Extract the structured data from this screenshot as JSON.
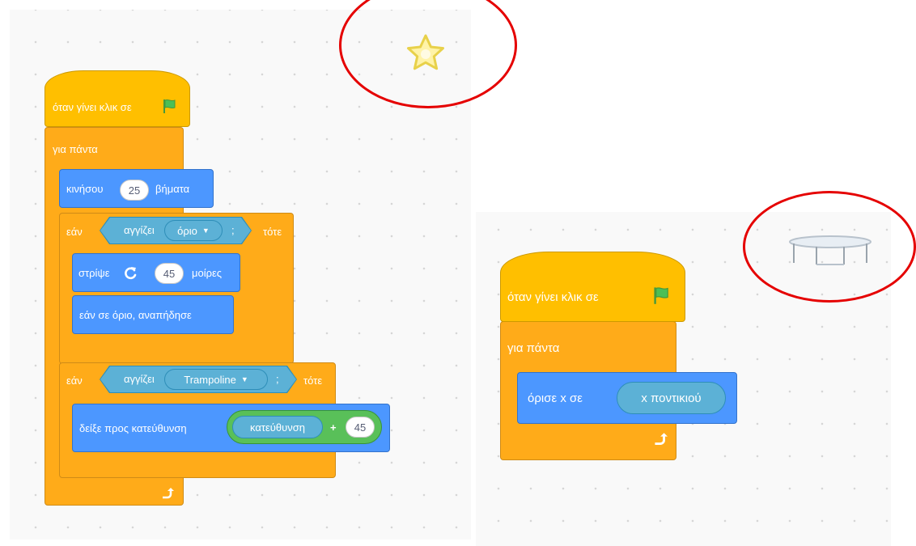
{
  "left_script": {
    "hat_label": "όταν γίνει κλικ σε",
    "forever_label": "για πάντα",
    "move": {
      "label_before": "κινήσου",
      "steps": "25",
      "label_after": "βήματα"
    },
    "if1": {
      "if_label": "εάν",
      "touching_label": "αγγίζει",
      "target": "όριο",
      "then_label": "τότε",
      "question": ";"
    },
    "turn": {
      "label_before": "στρίψε",
      "degrees": "45",
      "label_after": "μοίρες"
    },
    "bounce_label": "εάν σε όριο, αναπήδησε",
    "if2": {
      "if_label": "εάν",
      "touching_label": "αγγίζει",
      "target": "Trampoline",
      "then_label": "τότε",
      "question": ";"
    },
    "point": {
      "label": "δείξε προς κατεύθυνση",
      "direction_reporter": "κατεύθυνση",
      "operator": "+",
      "value": "45"
    }
  },
  "right_script": {
    "hat_label": "όταν γίνει κλικ σε",
    "forever_label": "για πάντα",
    "setx": {
      "label": "όρισε x σε",
      "reporter": "x ποντικιού"
    }
  },
  "sprites": {
    "left": "star-sprite",
    "right": "trampoline-sprite"
  },
  "colors": {
    "events": "#ffbf00",
    "control": "#ffab19",
    "motion": "#4c97ff",
    "sensing": "#5cb1d6",
    "operators": "#59c059",
    "highlight": "#e50000"
  }
}
